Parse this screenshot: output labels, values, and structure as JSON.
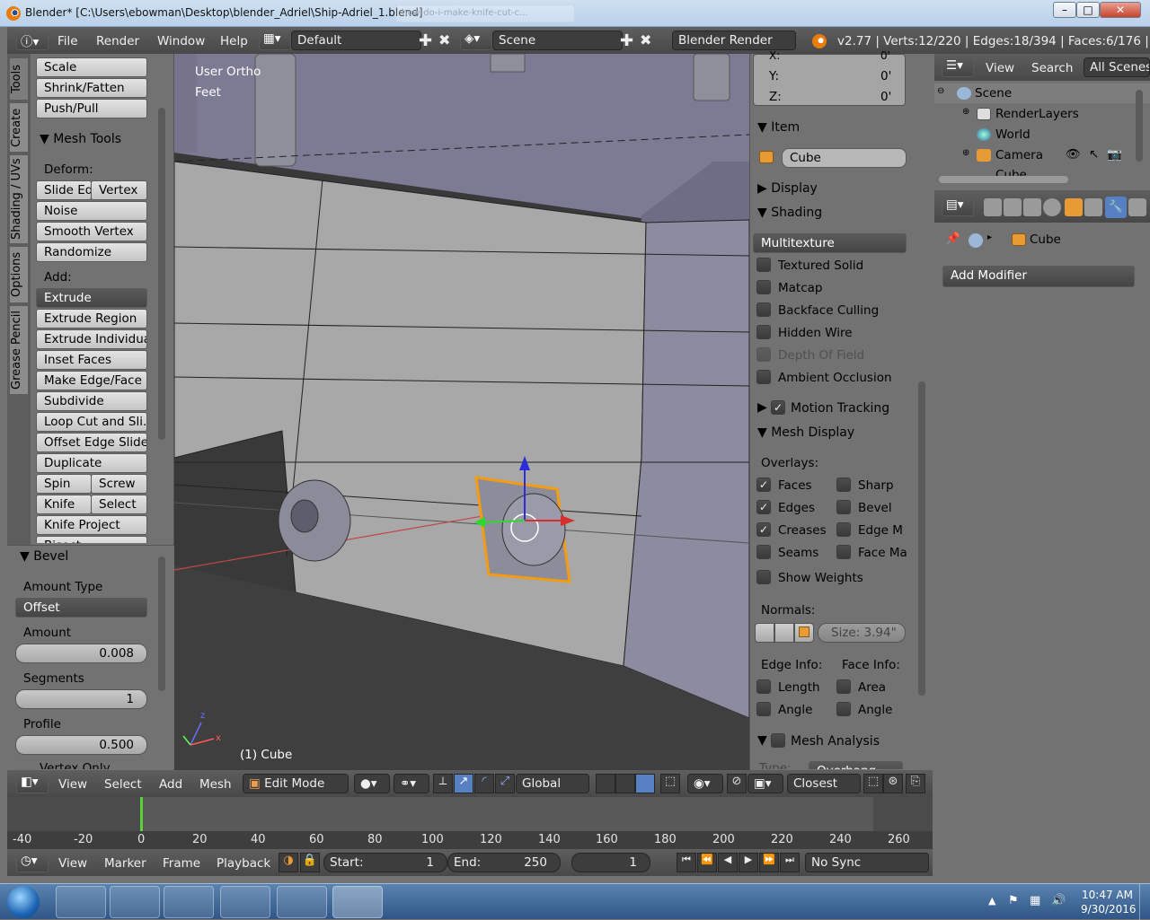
{
  "titlebar": {
    "title": "Blender* [C:\\Users\\ebowman\\Desktop\\blender_Adriel\\Ship-Adriel_1.blend]",
    "ghost_tab": "how-do-i-make-knife-cut-c...",
    "minimize": "–",
    "maximize": "□",
    "close": "✕"
  },
  "info_bar": {
    "menus": [
      "File",
      "Render",
      "Window",
      "Help"
    ],
    "screen": "Default",
    "scene": "Scene",
    "engine": "Blender Render",
    "stats": "v2.77 | Verts:12/220 | Edges:18/394 | Faces:6/176 | Tris"
  },
  "tool_tabs": [
    "Tools",
    "Create",
    "Shading / UVs",
    "Options",
    "Grease Pencil"
  ],
  "tools": {
    "top_buttons": [
      "Scale",
      "Shrink/Fatten",
      "Push/Pull"
    ],
    "section": "Mesh Tools",
    "deform_label": "Deform:",
    "slide_edge": "Slide Ed",
    "vertex": "Vertex",
    "deform_buttons": [
      "Noise",
      "Smooth Vertex",
      "Randomize"
    ],
    "add_label": "Add:",
    "extrude": "Extrude",
    "add_buttons": [
      "Extrude Region",
      "Extrude Individual",
      "Inset Faces",
      "Make Edge/Face",
      "Subdivide",
      "Loop Cut and Sli...",
      "Offset Edge Slide",
      "Duplicate"
    ],
    "spin": "Spin",
    "screw": "Screw",
    "knife": "Knife",
    "select": "Select",
    "knife_project": "Knife Project",
    "cut_item": "Bisect"
  },
  "bevel": {
    "title": "Bevel",
    "amount_type_label": "Amount Type",
    "amount_type": "Offset",
    "amount_label": "Amount",
    "amount": "0.008",
    "segments_label": "Segments",
    "segments": "1",
    "profile_label": "Profile",
    "profile": "0.500",
    "vertex_only": "Vertex Only"
  },
  "viewport": {
    "view_name": "User Ortho",
    "units": "Feet",
    "object_label": "(1) Cube",
    "axis_z": "z",
    "axis_x": "x"
  },
  "properties": {
    "x_label": "X:",
    "x_val": "0'",
    "y_label": "Y:",
    "y_val": "0'",
    "z_label": "Z:",
    "z_val": "0'",
    "item": "Item",
    "object_name": "Cube",
    "display": "Display",
    "shading": "Shading",
    "shading_mode": "Multitexture",
    "shading_opts": [
      "Textured Solid",
      "Matcap",
      "Backface Culling",
      "Hidden Wire"
    ],
    "depth_of_field": "Depth Of Field",
    "ambient_occlusion": "Ambient Occlusion",
    "motion_tracking": "Motion Tracking",
    "mesh_display": "Mesh Display",
    "overlays": "Overlays:",
    "overlay_left": [
      {
        "label": "Faces",
        "checked": true
      },
      {
        "label": "Edges",
        "checked": true
      },
      {
        "label": "Creases",
        "checked": true
      },
      {
        "label": "Seams",
        "checked": false
      }
    ],
    "overlay_right": [
      {
        "label": "Sharp",
        "checked": false
      },
      {
        "label": "Bevel",
        "checked": false
      },
      {
        "label": "Edge M",
        "checked": false
      },
      {
        "label": "Face Ma",
        "checked": false
      }
    ],
    "show_weights": "Show Weights",
    "normals": "Normals:",
    "normals_size": "Size: 3.94\"",
    "edge_info": "Edge Info:",
    "face_info": "Face Info:",
    "length": "Length",
    "area": "Area",
    "angle": "Angle",
    "mesh_analysis": "Mesh Analysis",
    "type_label": "Type:",
    "type_val": "Overhang"
  },
  "outliner": {
    "view": "View",
    "search": "Search",
    "filter": "All Scenes",
    "items": [
      "Scene",
      "RenderLayers",
      "World",
      "Camera",
      "Cube"
    ]
  },
  "modifiers": {
    "object": "Cube",
    "add_modifier": "Add Modifier"
  },
  "view3d_header": {
    "menus": [
      "View",
      "Select",
      "Add",
      "Mesh"
    ],
    "mode": "Edit Mode",
    "orientation": "Global",
    "snap": "Closest"
  },
  "timeline": {
    "ticks": [
      "-40",
      "-20",
      "0",
      "20",
      "40",
      "60",
      "80",
      "100",
      "120",
      "140",
      "160",
      "180",
      "200",
      "220",
      "240",
      "260"
    ],
    "menus": [
      "View",
      "Marker",
      "Frame",
      "Playback"
    ],
    "start_label": "Start:",
    "start": "1",
    "end_label": "End:",
    "end": "250",
    "current": "1",
    "sync": "No Sync"
  },
  "taskbar": {
    "time": "10:47 AM",
    "date": "9/30/2016"
  },
  "colors": {
    "panel": "#727272",
    "viewport_grid": "#3a3a3a",
    "mesh_face": "#a7a7a7",
    "selected": "#f39c12",
    "header": "#484848"
  }
}
